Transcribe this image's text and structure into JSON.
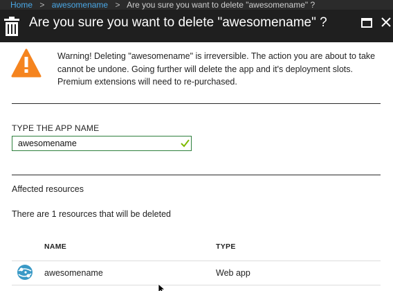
{
  "breadcrumb": {
    "items": [
      {
        "label": "Home"
      },
      {
        "label": "awesomename"
      },
      {
        "label": "Are you sure you want to delete \"awesomename\" ?"
      }
    ],
    "separator": ">"
  },
  "header": {
    "title": "Are you sure you want to delete \"awesomename\" ?",
    "icon": "trash-icon",
    "controls": [
      "maximize-icon",
      "close-icon"
    ]
  },
  "warning": {
    "icon": "warning-icon",
    "text": "Warning! Deleting \"awesomename\" is irreversible. The action you are about to take cannot be undone. Going further will delete the app and it's deployment slots. Premium extensions will need to re-purchased."
  },
  "form": {
    "label": "TYPE THE APP NAME",
    "value": "awesomename",
    "valid_icon": "check-icon"
  },
  "resources": {
    "heading": "Affected resources",
    "count_text": "There are 1 resources that will be deleted",
    "columns": [
      "NAME",
      "TYPE"
    ],
    "rows": [
      {
        "icon": "web-app-icon",
        "name": "awesomename",
        "type": "Web app"
      }
    ]
  },
  "colors": {
    "header_bg": "#1f1f1f",
    "breadcrumb_link": "#4aa8e6",
    "warning_orange": "#f5841f",
    "valid_green": "#2d7f3c",
    "check_green": "#7fba00",
    "webapp_blue": "#3999c6"
  }
}
